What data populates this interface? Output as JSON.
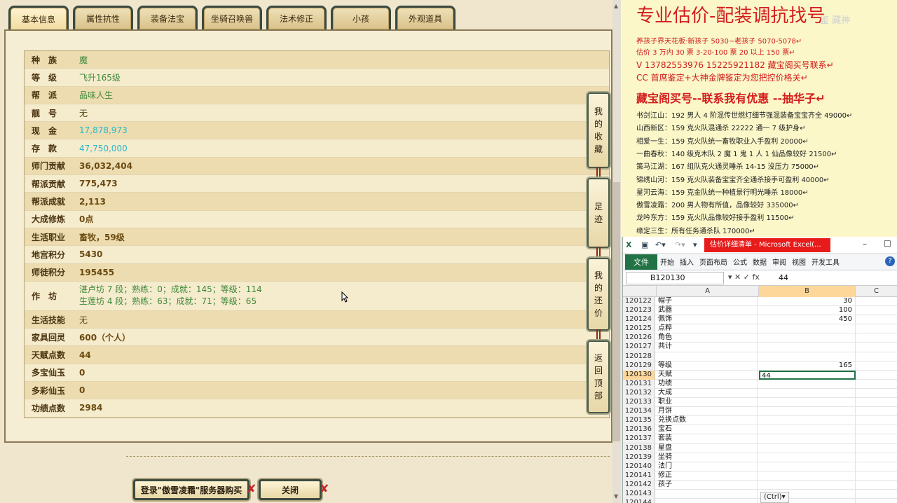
{
  "tabs": [
    "基本信息",
    "属性抗性",
    "装备法宝",
    "坐骑召唤兽",
    "法术修正",
    "小孩",
    "外观道具"
  ],
  "info_rows": [
    {
      "label": "种　族",
      "value": "魔",
      "style": "green"
    },
    {
      "label": "等　级",
      "value": "飞升165级",
      "style": "green"
    },
    {
      "label": "帮　派",
      "value": "品味人生",
      "style": "green"
    },
    {
      "label": "靓　号",
      "value": "无",
      "style": "plain"
    },
    {
      "label": "现　金",
      "value": "17,878,973",
      "style": "cyan"
    },
    {
      "label": "存　款",
      "value": "47,750,000",
      "style": "cyan"
    },
    {
      "label": "师门贡献",
      "value": "36,032,404",
      "style": "bold"
    },
    {
      "label": "帮派贡献",
      "value": "775,473",
      "style": "bold"
    },
    {
      "label": "帮派成就",
      "value": "2,113",
      "style": "bold"
    },
    {
      "label": "大成修炼",
      "value": "0点",
      "style": "bold"
    },
    {
      "label": "生活职业",
      "value": "畜牧，59级",
      "style": "bold"
    },
    {
      "label": "地宫积分",
      "value": "5430",
      "style": "bold"
    },
    {
      "label": "师徒积分",
      "value": "195455",
      "style": "bold"
    }
  ],
  "workshop": {
    "label": "作　坊",
    "line1": "湛卢坊 7 段；熟练：0；成就：145；等级：114",
    "line2": "生莲坊 4 段；熟练：63；成就：71；等级：65"
  },
  "info_rows_after": [
    {
      "label": "生活技能",
      "value": "无",
      "style": "plain"
    },
    {
      "label": "家具回灵",
      "value": "600（个人）",
      "style": "bold"
    },
    {
      "label": "天赋点数",
      "value": "44",
      "style": "bold"
    },
    {
      "label": "多宝仙玉",
      "value": "0",
      "style": "bold"
    },
    {
      "label": "多彩仙玉",
      "value": "0",
      "style": "bold"
    },
    {
      "label": "功绩点数",
      "value": "2984",
      "style": "bold"
    }
  ],
  "side_buttons": [
    {
      "name": "my-favorites-button",
      "chars": [
        "我",
        "的",
        "收",
        "藏"
      ]
    },
    {
      "name": "footprint-button",
      "chars": [
        "足",
        "迹"
      ]
    },
    {
      "name": "my-counteroffer-button",
      "chars": [
        "我",
        "的",
        "还",
        "价"
      ]
    },
    {
      "name": "back-to-top-button",
      "chars": [
        "返",
        "回",
        "顶",
        "部"
      ]
    }
  ],
  "bottom_buttons": {
    "login_buy": "登录\"傲雪凌霜\"服务器购买",
    "close": "关闭"
  },
  "ad": {
    "title": "专业估价-配装调抗找号",
    "watermark": "鉴 藏神",
    "line1": "养孩子界天花板·新孩子 5030~老孩子 5070-5078↵",
    "line2": "估价 3 万内 30 票    3-20-100 票      20 以上 150 票↵",
    "line3": "V 13782553976     15225921182    藏宝阁买号联系↵",
    "line4": "CC 首席鉴定+大神金牌鉴定为您把控价格关↵",
    "subtitle": "藏宝阁买号--联系我有优惠 --抽华子↵",
    "listings": [
      "书剑江山：192 男人 4 阶混传世燃灯细节强混装备宝宝齐全 49000↵",
      "山西新区：159 克火队混通杀 22222 通一 7 级护身↵",
      "相爱一生：159 克火队统一畜牧职业入手盈利 20000↵",
      "一曲春秋：140 级克木队 2 魔 1 鬼 1 人 1 仙品像较好 21500↵",
      "策马江湖：167 组队克火通灵睡杀 14-15 没压力 75000↵",
      "锦绣山河：159 克火队装备宝宝齐全通杀接手可盈利 40000↵",
      "星河云海：159 克金队统一种植景行明光睡杀 18000↵",
      "傲雪凌霜：200 男人物有所值，品像较好 335000↵",
      "龙吟东方：159 克火队品像较好接手盈利 11500↵",
      "缘定三生：所有任务通杀队 170000↵"
    ]
  },
  "excel": {
    "title": "估价详细清单 - Microsoft Excel(...",
    "menu": [
      "开始",
      "插入",
      "页面布局",
      "公式",
      "数据",
      "审阅",
      "视图",
      "开发工具"
    ],
    "file_label": "文件",
    "namebox": "B120130",
    "formula_value": "44",
    "columns": [
      "A",
      "B",
      "C"
    ],
    "rows": [
      {
        "n": "120122",
        "a": "帽子",
        "b": "30"
      },
      {
        "n": "120123",
        "a": "武器",
        "b": "100"
      },
      {
        "n": "120124",
        "a": "佩饰",
        "b": "450"
      },
      {
        "n": "120125",
        "a": "点粹",
        "b": ""
      },
      {
        "n": "120126",
        "a": "角色",
        "b": ""
      },
      {
        "n": "120127",
        "a": "共计",
        "b": ""
      },
      {
        "n": "120128",
        "a": "",
        "b": ""
      },
      {
        "n": "120129",
        "a": "等级",
        "b": "165"
      },
      {
        "n": "120130",
        "a": "天赋",
        "b": "44",
        "active": true
      },
      {
        "n": "120131",
        "a": "功绩",
        "b": ""
      },
      {
        "n": "120132",
        "a": "大成",
        "b": ""
      },
      {
        "n": "120133",
        "a": "职业",
        "b": ""
      },
      {
        "n": "120134",
        "a": "月饼",
        "b": ""
      },
      {
        "n": "120135",
        "a": "兑换点数",
        "b": ""
      },
      {
        "n": "120136",
        "a": "宝石",
        "b": ""
      },
      {
        "n": "120137",
        "a": "套装",
        "b": ""
      },
      {
        "n": "120138",
        "a": "星盘",
        "b": ""
      },
      {
        "n": "120139",
        "a": "坐骑",
        "b": ""
      },
      {
        "n": "120140",
        "a": "法门",
        "b": ""
      },
      {
        "n": "120141",
        "a": "修正",
        "b": ""
      },
      {
        "n": "120142",
        "a": "孩子",
        "b": ""
      },
      {
        "n": "120143",
        "a": "",
        "b": ""
      },
      {
        "n": "120144",
        "a": "",
        "b": ""
      }
    ],
    "paste_ctrl": "(Ctrl)▾"
  },
  "colors": {
    "ad_red": "#d41d1d",
    "excel_green": "#217346",
    "excel_title_red": "#e81b1b",
    "value_cyan": "#2bb8c8",
    "value_green": "#3f8a3a"
  }
}
